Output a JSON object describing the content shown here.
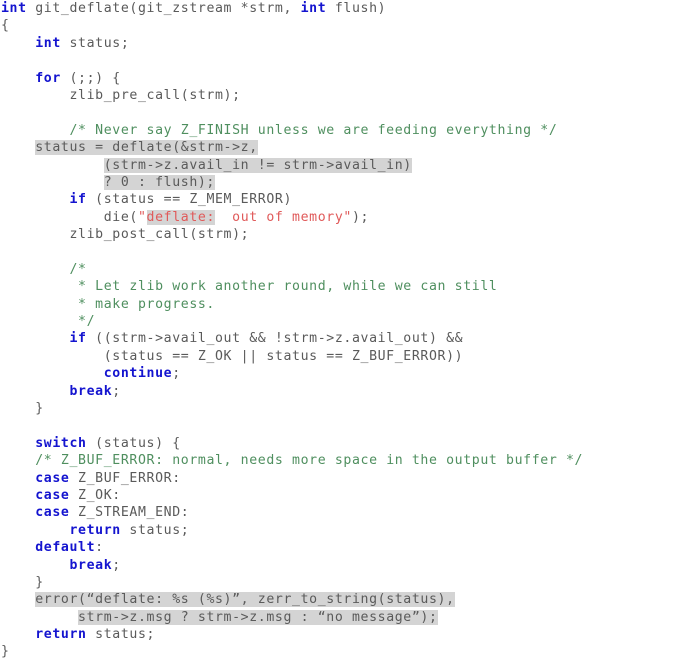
{
  "document": {
    "kind": "source-code-listing",
    "language": "C",
    "function_name": "git_deflate",
    "background_color": "#ffffff",
    "colors": {
      "plain_text": "#5a5a5a",
      "keyword": "#1414cf",
      "comment": "#4f8f5f",
      "string": "#e05a5a",
      "highlight_background": "#d4d4d4"
    }
  },
  "lines": [
    {
      "n": 1,
      "indent": 0,
      "tokens": [
        {
          "t": "int",
          "c": "keyword"
        },
        {
          "t": " git_deflate(git_zstream *strm, ",
          "c": "plain"
        },
        {
          "t": "int",
          "c": "keyword"
        },
        {
          "t": " flush)",
          "c": "plain"
        }
      ]
    },
    {
      "n": 2,
      "indent": 0,
      "tokens": [
        {
          "t": "{",
          "c": "plain"
        }
      ]
    },
    {
      "n": 3,
      "indent": 1,
      "tokens": [
        {
          "t": "int",
          "c": "keyword"
        },
        {
          "t": " status;",
          "c": "plain"
        }
      ]
    },
    {
      "n": 4,
      "indent": 0,
      "tokens": []
    },
    {
      "n": 5,
      "indent": 1,
      "tokens": [
        {
          "t": "for",
          "c": "keyword"
        },
        {
          "t": " (;;) {",
          "c": "plain"
        }
      ]
    },
    {
      "n": 6,
      "indent": 2,
      "tokens": [
        {
          "t": "zlib_pre_call(strm);",
          "c": "plain"
        }
      ]
    },
    {
      "n": 7,
      "indent": 0,
      "tokens": []
    },
    {
      "n": 8,
      "indent": 2,
      "tokens": [
        {
          "t": "/* Never say Z_FINISH unless we are feeding everything */",
          "c": "comment"
        }
      ]
    },
    {
      "n": 9,
      "indent": 1,
      "tokens": [
        {
          "t": "status = deflate(&strm->z,",
          "c": "plain",
          "hl": true
        }
      ]
    },
    {
      "n": 10,
      "indent": 0,
      "pad": 12,
      "tokens": [
        {
          "t": "(strm->z.avail_in != strm->avail_in)",
          "c": "plain",
          "hl": true
        }
      ]
    },
    {
      "n": 11,
      "indent": 0,
      "pad": 12,
      "tokens": [
        {
          "t": "? 0 : flush);",
          "c": "plain",
          "hl": true
        }
      ]
    },
    {
      "n": 12,
      "indent": 2,
      "tokens": [
        {
          "t": "if",
          "c": "keyword"
        },
        {
          "t": " (status == Z_MEM_ERROR)",
          "c": "plain"
        }
      ]
    },
    {
      "n": 13,
      "indent": 3,
      "tokens": [
        {
          "t": "die(",
          "c": "plain"
        },
        {
          "t": "\"",
          "c": "string"
        },
        {
          "t": "deflate:",
          "c": "string",
          "hl": true
        },
        {
          "t": "  out of memory\"",
          "c": "string"
        },
        {
          "t": ");",
          "c": "plain"
        }
      ]
    },
    {
      "n": 14,
      "indent": 2,
      "tokens": [
        {
          "t": "zlib_post_call(strm);",
          "c": "plain"
        }
      ]
    },
    {
      "n": 15,
      "indent": 0,
      "tokens": []
    },
    {
      "n": 16,
      "indent": 2,
      "tokens": [
        {
          "t": "/*",
          "c": "comment"
        }
      ]
    },
    {
      "n": 17,
      "indent": 2,
      "tokens": [
        {
          "t": " * Let zlib work another round, while we can still",
          "c": "comment"
        }
      ]
    },
    {
      "n": 18,
      "indent": 2,
      "tokens": [
        {
          "t": " * make progress.",
          "c": "comment"
        }
      ]
    },
    {
      "n": 19,
      "indent": 2,
      "tokens": [
        {
          "t": " */",
          "c": "comment"
        }
      ]
    },
    {
      "n": 20,
      "indent": 2,
      "tokens": [
        {
          "t": "if",
          "c": "keyword"
        },
        {
          "t": " ((strm->avail_out && !strm->z.avail_out) &&",
          "c": "plain"
        }
      ]
    },
    {
      "n": 21,
      "indent": 0,
      "pad": 12,
      "tokens": [
        {
          "t": "(status == Z_OK || status == Z_BUF_ERROR))",
          "c": "plain"
        }
      ]
    },
    {
      "n": 22,
      "indent": 3,
      "tokens": [
        {
          "t": "continue",
          "c": "keyword"
        },
        {
          "t": ";",
          "c": "plain"
        }
      ]
    },
    {
      "n": 23,
      "indent": 2,
      "tokens": [
        {
          "t": "break",
          "c": "keyword"
        },
        {
          "t": ";",
          "c": "plain"
        }
      ]
    },
    {
      "n": 24,
      "indent": 1,
      "tokens": [
        {
          "t": "}",
          "c": "plain"
        }
      ]
    },
    {
      "n": 25,
      "indent": 0,
      "tokens": []
    },
    {
      "n": 26,
      "indent": 1,
      "tokens": [
        {
          "t": "switch",
          "c": "keyword"
        },
        {
          "t": " (status) {",
          "c": "plain"
        }
      ]
    },
    {
      "n": 27,
      "indent": 1,
      "tokens": [
        {
          "t": "/* Z_BUF_ERROR: normal, needs more space in the output buffer */",
          "c": "comment"
        }
      ]
    },
    {
      "n": 28,
      "indent": 1,
      "tokens": [
        {
          "t": "case",
          "c": "keyword"
        },
        {
          "t": " Z_BUF_ERROR:",
          "c": "plain"
        }
      ]
    },
    {
      "n": 29,
      "indent": 1,
      "tokens": [
        {
          "t": "case",
          "c": "keyword"
        },
        {
          "t": " Z_OK:",
          "c": "plain"
        }
      ]
    },
    {
      "n": 30,
      "indent": 1,
      "tokens": [
        {
          "t": "case",
          "c": "keyword"
        },
        {
          "t": " Z_STREAM_END:",
          "c": "plain"
        }
      ]
    },
    {
      "n": 31,
      "indent": 2,
      "tokens": [
        {
          "t": "return",
          "c": "keyword"
        },
        {
          "t": " status;",
          "c": "plain"
        }
      ]
    },
    {
      "n": 32,
      "indent": 1,
      "tokens": [
        {
          "t": "default",
          "c": "keyword"
        },
        {
          "t": ":",
          "c": "plain"
        }
      ]
    },
    {
      "n": 33,
      "indent": 2,
      "tokens": [
        {
          "t": "break",
          "c": "keyword"
        },
        {
          "t": ";",
          "c": "plain"
        }
      ]
    },
    {
      "n": 34,
      "indent": 1,
      "tokens": [
        {
          "t": "}",
          "c": "plain"
        }
      ]
    },
    {
      "n": 35,
      "indent": 1,
      "tokens": [
        {
          "t": "error(“deflate: %s (%s)”, zerr_to_string(status),",
          "c": "plain",
          "hl": true
        }
      ]
    },
    {
      "n": 36,
      "indent": 0,
      "pad": 9,
      "tokens": [
        {
          "t": "strm->z.msg ? strm->z.msg : “no message”);",
          "c": "plain",
          "hl": true
        }
      ]
    },
    {
      "n": 37,
      "indent": 1,
      "tokens": [
        {
          "t": "return",
          "c": "keyword"
        },
        {
          "t": " status;",
          "c": "plain"
        }
      ]
    },
    {
      "n": 38,
      "indent": 0,
      "tokens": [
        {
          "t": "}",
          "c": "plain"
        }
      ]
    }
  ]
}
